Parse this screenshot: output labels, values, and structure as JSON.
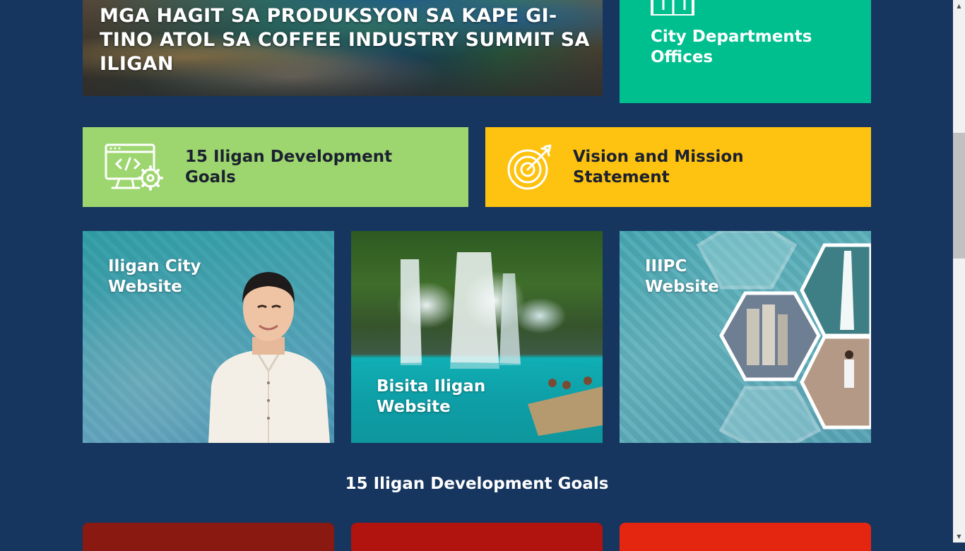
{
  "news": {
    "title": "MGA HAGIT SA PRODUKSYON SA KAPE GI-TINO ATOL SA COFFEE INDUSTRY SUMMIT SA ILIGAN"
  },
  "city_departments": {
    "label": "City Departments Offices",
    "icon": "map-icon",
    "color": "#00bf8f"
  },
  "banners": {
    "dev_goals": {
      "label": "15 Iligan Development Goals",
      "icon": "code-settings-icon",
      "color": "#9dd66f"
    },
    "vision": {
      "label": "Vision and Mission Statement",
      "icon": "target-icon",
      "color": "#fec210"
    }
  },
  "tiles": {
    "iligan_city": {
      "label": "Iligan City Website"
    },
    "bisita": {
      "label": "Bisita Iligan Website"
    },
    "iiipc": {
      "label": "IIIPC Website"
    }
  },
  "section": {
    "heading": "15 Iligan Development Goals"
  },
  "goal_cards": {
    "colors": [
      "#8a1a11",
      "#b1140e",
      "#e42611"
    ]
  }
}
